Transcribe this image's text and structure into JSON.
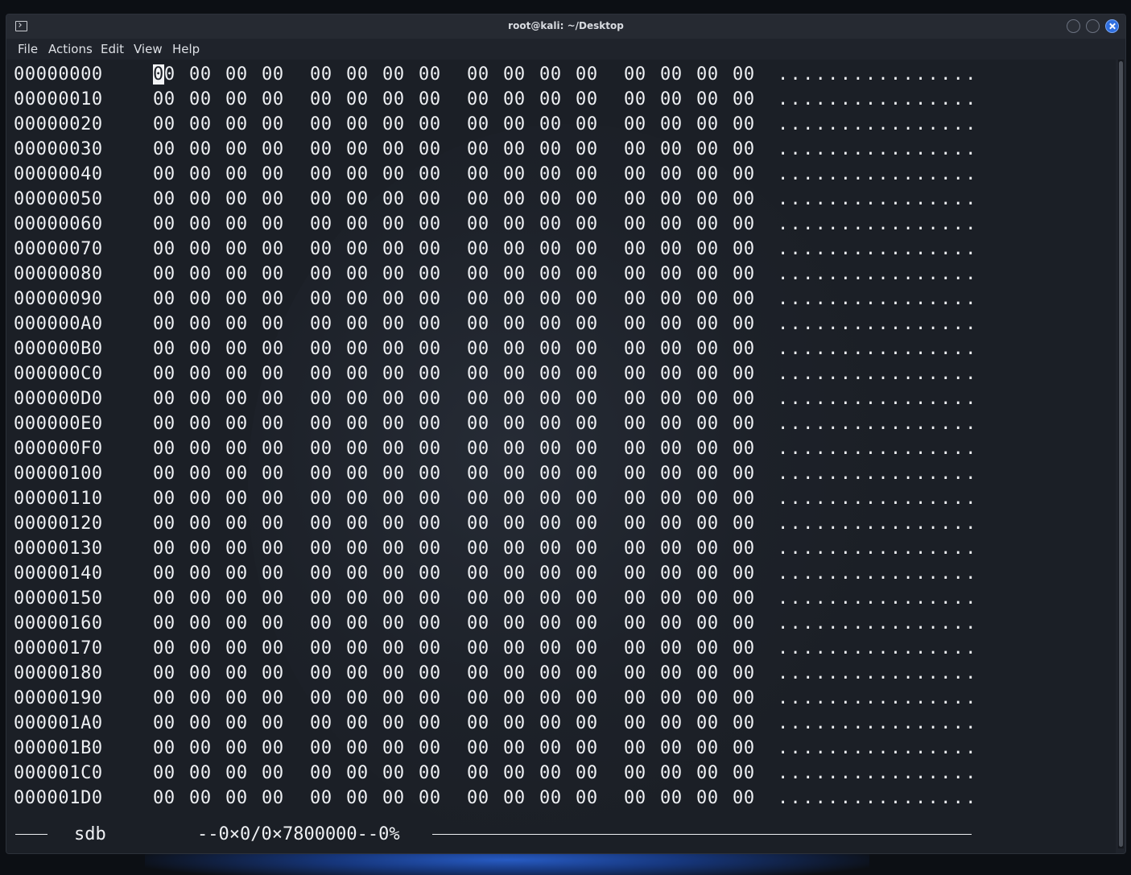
{
  "window": {
    "title": "root@kali: ~/Desktop",
    "menu": [
      "File",
      "Actions",
      "Edit",
      "View",
      "Help"
    ]
  },
  "hexview": {
    "rows": [
      {
        "offset": "00000000",
        "ascii": "................"
      },
      {
        "offset": "00000010",
        "ascii": "................"
      },
      {
        "offset": "00000020",
        "ascii": "................"
      },
      {
        "offset": "00000030",
        "ascii": "................"
      },
      {
        "offset": "00000040",
        "ascii": "................"
      },
      {
        "offset": "00000050",
        "ascii": "................"
      },
      {
        "offset": "00000060",
        "ascii": "................"
      },
      {
        "offset": "00000070",
        "ascii": "................"
      },
      {
        "offset": "00000080",
        "ascii": "................"
      },
      {
        "offset": "00000090",
        "ascii": "................"
      },
      {
        "offset": "000000A0",
        "ascii": "................"
      },
      {
        "offset": "000000B0",
        "ascii": "................"
      },
      {
        "offset": "000000C0",
        "ascii": "................"
      },
      {
        "offset": "000000D0",
        "ascii": "................"
      },
      {
        "offset": "000000E0",
        "ascii": "................"
      },
      {
        "offset": "000000F0",
        "ascii": "................"
      },
      {
        "offset": "00000100",
        "ascii": "................"
      },
      {
        "offset": "00000110",
        "ascii": "................"
      },
      {
        "offset": "00000120",
        "ascii": "................"
      },
      {
        "offset": "00000130",
        "ascii": "................"
      },
      {
        "offset": "00000140",
        "ascii": "................"
      },
      {
        "offset": "00000150",
        "ascii": "................"
      },
      {
        "offset": "00000160",
        "ascii": "................"
      },
      {
        "offset": "00000170",
        "ascii": "................"
      },
      {
        "offset": "00000180",
        "ascii": "................"
      },
      {
        "offset": "00000190",
        "ascii": "................"
      },
      {
        "offset": "000001A0",
        "ascii": "................"
      },
      {
        "offset": "000001B0",
        "ascii": "................"
      },
      {
        "offset": "000001C0",
        "ascii": "................"
      },
      {
        "offset": "000001D0",
        "ascii": "................"
      }
    ],
    "byte_value": "00",
    "bytes_per_row": 16
  },
  "status": {
    "name": "sdb",
    "position": "--0×0/0×7800000--0%"
  }
}
